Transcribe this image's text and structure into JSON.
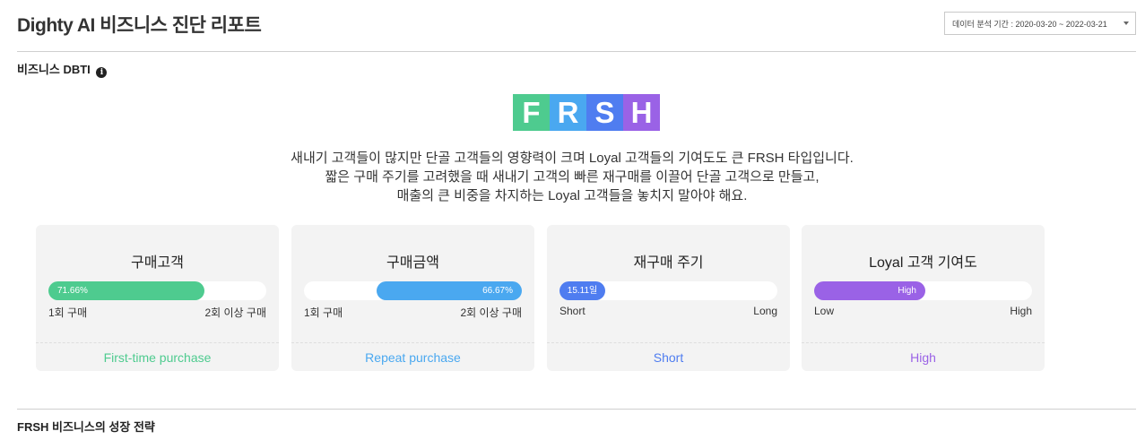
{
  "header": {
    "title": "Dighty AI 비즈니스 진단 리포트",
    "period_label": "데이터 분석 기간 : 2020-03-20 ~ 2022-03-21"
  },
  "dbti": {
    "section_title": "비즈니스 DBTI",
    "info_icon": "info-icon",
    "type_letters": [
      "F",
      "R",
      "S",
      "H"
    ],
    "type_colors": [
      "#4ecb8f",
      "#4aa8f0",
      "#4f7df0",
      "#9a62e6"
    ],
    "description": [
      "새내기 고객들이 많지만 단골 고객들의 영향력이 크며 Loyal 고객들의 기여도도 큰 FRSH 타입입니다.",
      "짧은 구매 주기를 고려했을 때 새내기 고객의 빠른 재구매를 이끌어 단골 고객으로 만들고,",
      "매출의 큰 비중을 차지하는 Loyal 고객들을 놓치지 말아야 해요."
    ]
  },
  "cards": [
    {
      "title": "구매고객",
      "bar_label": "71.66%",
      "fill_start": 0,
      "fill_end": 0.7166,
      "color": "#4ecb8f",
      "label_align": "left",
      "scale_left": "1회 구매",
      "scale_right": "2회 이상 구매",
      "result": "First-time purchase"
    },
    {
      "title": "구매금액",
      "bar_label": "66.67%",
      "fill_start": 0.3333,
      "fill_end": 1.0,
      "color": "#4aa8f0",
      "label_align": "right",
      "scale_left": "1회 구매",
      "scale_right": "2회 이상 구매",
      "result": "Repeat purchase"
    },
    {
      "title": "재구매 주기",
      "bar_label": "15.11일",
      "fill_start": 0,
      "fill_end": 0.21,
      "color": "#4f7df0",
      "label_align": "center",
      "scale_left": "Short",
      "scale_right": "Long",
      "result": "Short"
    },
    {
      "title": "Loyal 고객 기여도",
      "bar_label": "High",
      "fill_start": 0,
      "fill_end": 0.51,
      "color": "#9a62e6",
      "label_align": "right",
      "scale_left": "Low",
      "scale_right": "High",
      "result": "High"
    }
  ],
  "strategy": {
    "section_title": "FRSH 비즈니스의 성장 전략"
  }
}
